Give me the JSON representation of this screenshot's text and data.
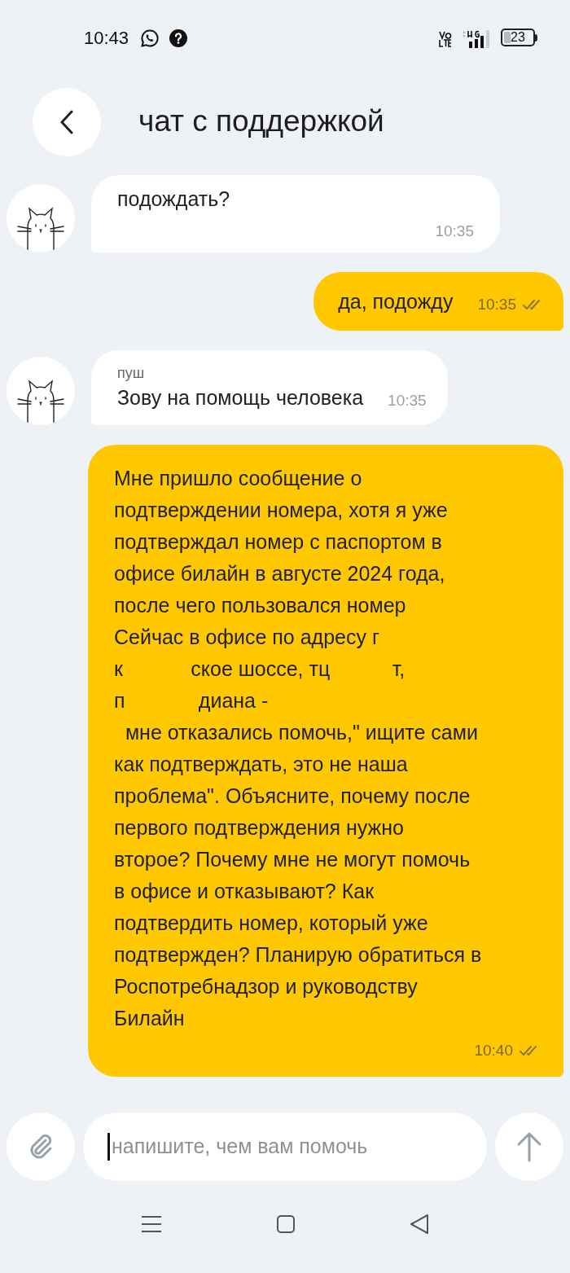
{
  "status_bar": {
    "time": "10:43",
    "battery": "23"
  },
  "header": {
    "title": "чат с поддержкой"
  },
  "messages": [
    {
      "kind": "incoming",
      "text": "подождать?",
      "time": "10:35",
      "time_below": true
    },
    {
      "kind": "outgoing",
      "text": "да, подожду",
      "time": "10:35",
      "time_below": false,
      "read": true
    },
    {
      "kind": "incoming",
      "sender": "пуш",
      "text": "Зову на помощь человека",
      "time": "10:35",
      "time_below": false
    },
    {
      "kind": "outgoing",
      "text": "Мне пришло сообщение о\nподтверждении номера, хотя я уже\nподтверждал номер с паспортом в\nофисе билайн в августе 2024 года,\nпосле чего пользовался номер\nСейчас в офисе по адресу г\nк            ское шоссе, тц           т,\nп             диана -\n  мне отказались помочь,\" ищите сами\nкак подтверждать, это не наша\nпроблема\". Объясните, почему после\nпервого подтверждения нужно\nвторое? Почему мне не могут помочь\nв офисе и отказывают? Как\nподтвердить номер, который уже\nподтвержден? Планирую обратиться в\nРоспотребнадзор и руководству\nБилайн",
      "time": "10:40",
      "time_below": true,
      "read": true
    }
  ],
  "composer": {
    "placeholder": "напишите, чем вам помочь"
  }
}
